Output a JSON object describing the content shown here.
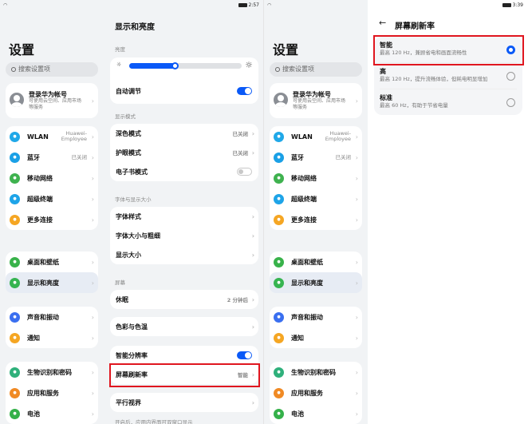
{
  "colors": {
    "accent": "#0a59f7",
    "highlight": "#e0161f"
  },
  "panel1": {
    "status": {
      "time": "2:57",
      "wifi": "wifi-icon"
    },
    "settings_title": "设置",
    "search_placeholder": "搜索设置项",
    "account": {
      "name": "登录华为帐号",
      "desc": "可使用云空间、应用市场等服务"
    },
    "groups": [
      [
        {
          "label": "WLAN",
          "value": "Huawei-Employee",
          "color": "#20a8e8",
          "icon": "wifi-icon"
        },
        {
          "label": "蓝牙",
          "value": "已关闭",
          "color": "#1aa0e6",
          "icon": "bluetooth-icon"
        },
        {
          "label": "移动网络",
          "value": "",
          "color": "#3fb24f",
          "icon": "signal-icon"
        },
        {
          "label": "超级终端",
          "value": "",
          "color": "#1ea4e8",
          "icon": "super-device-icon"
        },
        {
          "label": "更多连接",
          "value": "",
          "color": "#f5a623",
          "icon": "link-icon"
        }
      ],
      [
        {
          "label": "桌面和壁纸",
          "value": "",
          "color": "#38b24a",
          "icon": "wallpaper-icon"
        },
        {
          "label": "显示和亮度",
          "value": "",
          "color": "#36b451",
          "icon": "display-icon"
        }
      ],
      [
        {
          "label": "声音和振动",
          "value": "",
          "color": "#3a6ff0",
          "icon": "sound-icon"
        },
        {
          "label": "通知",
          "value": "",
          "color": "#f5a623",
          "icon": "bell-icon"
        }
      ],
      [
        {
          "label": "生物识别和密码",
          "value": "",
          "color": "#2fb07b",
          "icon": "key-icon"
        },
        {
          "label": "应用和服务",
          "value": "",
          "color": "#f08a24",
          "icon": "apps-icon"
        },
        {
          "label": "电池",
          "value": "",
          "color": "#35b14a",
          "icon": "battery-icon"
        }
      ]
    ],
    "right": {
      "title": "显示和亮度",
      "brightness_label": "亮度",
      "brightness_value": 0.42,
      "auto_adjust": "自动调节",
      "section_display_mode": "显示模式",
      "dark_mode": {
        "label": "深色模式",
        "value": "已关闭"
      },
      "eye_comfort": {
        "label": "护眼模式",
        "value": "已关闭"
      },
      "ebook_mode": "电子书模式",
      "section_font": "字体与显示大小",
      "font_style": "字体样式",
      "font_size": "字体大小与粗细",
      "display_size": "显示大小",
      "section_screen": "屏幕",
      "sleep": {
        "label": "休眠",
        "value": "2 分钟后"
      },
      "color_temp": "色彩与色温",
      "smart_resolution": "智能分辨率",
      "refresh_rate": {
        "label": "屏幕刷新率",
        "value": "智能"
      },
      "parallel_view": "平行视界",
      "parallel_hint": "开启后，应用内界面可双窗口显示"
    }
  },
  "panel2": {
    "status": {
      "time": "3:39",
      "wifi": "wifi-icon"
    },
    "settings_title": "设置",
    "search_placeholder": "搜索设置项",
    "account": {
      "name": "登录华为帐号",
      "desc": "可使用云空间、应用市场等服务"
    },
    "groups": [
      [
        {
          "label": "WLAN",
          "value": "Huawei-Employee",
          "color": "#20a8e8",
          "icon": "wifi-icon"
        },
        {
          "label": "蓝牙",
          "value": "已关闭",
          "color": "#1aa0e6",
          "icon": "bluetooth-icon"
        },
        {
          "label": "移动网络",
          "value": "",
          "color": "#3fb24f",
          "icon": "signal-icon"
        },
        {
          "label": "超级终端",
          "value": "",
          "color": "#1ea4e8",
          "icon": "super-device-icon"
        },
        {
          "label": "更多连接",
          "value": "",
          "color": "#f5a623",
          "icon": "link-icon"
        }
      ],
      [
        {
          "label": "桌面和壁纸",
          "value": "",
          "color": "#38b24a",
          "icon": "wallpaper-icon"
        },
        {
          "label": "显示和亮度",
          "value": "",
          "color": "#36b451",
          "icon": "display-icon"
        }
      ],
      [
        {
          "label": "声音和振动",
          "value": "",
          "color": "#3a6ff0",
          "icon": "sound-icon"
        },
        {
          "label": "通知",
          "value": "",
          "color": "#f5a623",
          "icon": "bell-icon"
        }
      ],
      [
        {
          "label": "生物识别和密码",
          "value": "",
          "color": "#2fb07b",
          "icon": "key-icon"
        },
        {
          "label": "应用和服务",
          "value": "",
          "color": "#f08a24",
          "icon": "apps-icon"
        },
        {
          "label": "电池",
          "value": "",
          "color": "#35b14a",
          "icon": "battery-icon"
        }
      ]
    ],
    "right": {
      "title": "屏幕刷新率",
      "options": [
        {
          "title": "智能",
          "desc": "最高 120 Hz，兼顾省电和画面流畅性",
          "selected": true
        },
        {
          "title": "高",
          "desc": "最高 120 Hz，提升流畅体验，但耗电明显增加",
          "selected": false
        },
        {
          "title": "标准",
          "desc": "最高 60 Hz，有助于节省电量",
          "selected": false
        }
      ]
    }
  }
}
